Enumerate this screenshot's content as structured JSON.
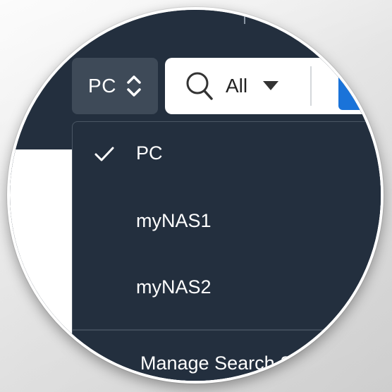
{
  "source_selector": {
    "label": "PC"
  },
  "search": {
    "scope_label": "All"
  },
  "dropdown": {
    "items": [
      {
        "label": "PC",
        "selected": true
      },
      {
        "label": "myNAS1",
        "selected": false
      },
      {
        "label": "myNAS2",
        "selected": false
      }
    ],
    "manage_label": "Manage Search Sources"
  },
  "colors": {
    "header_bg": "#232f3e",
    "button_bg": "#3e4a58",
    "accent_blue": "#1a73d9",
    "text_light": "#ffffff"
  }
}
